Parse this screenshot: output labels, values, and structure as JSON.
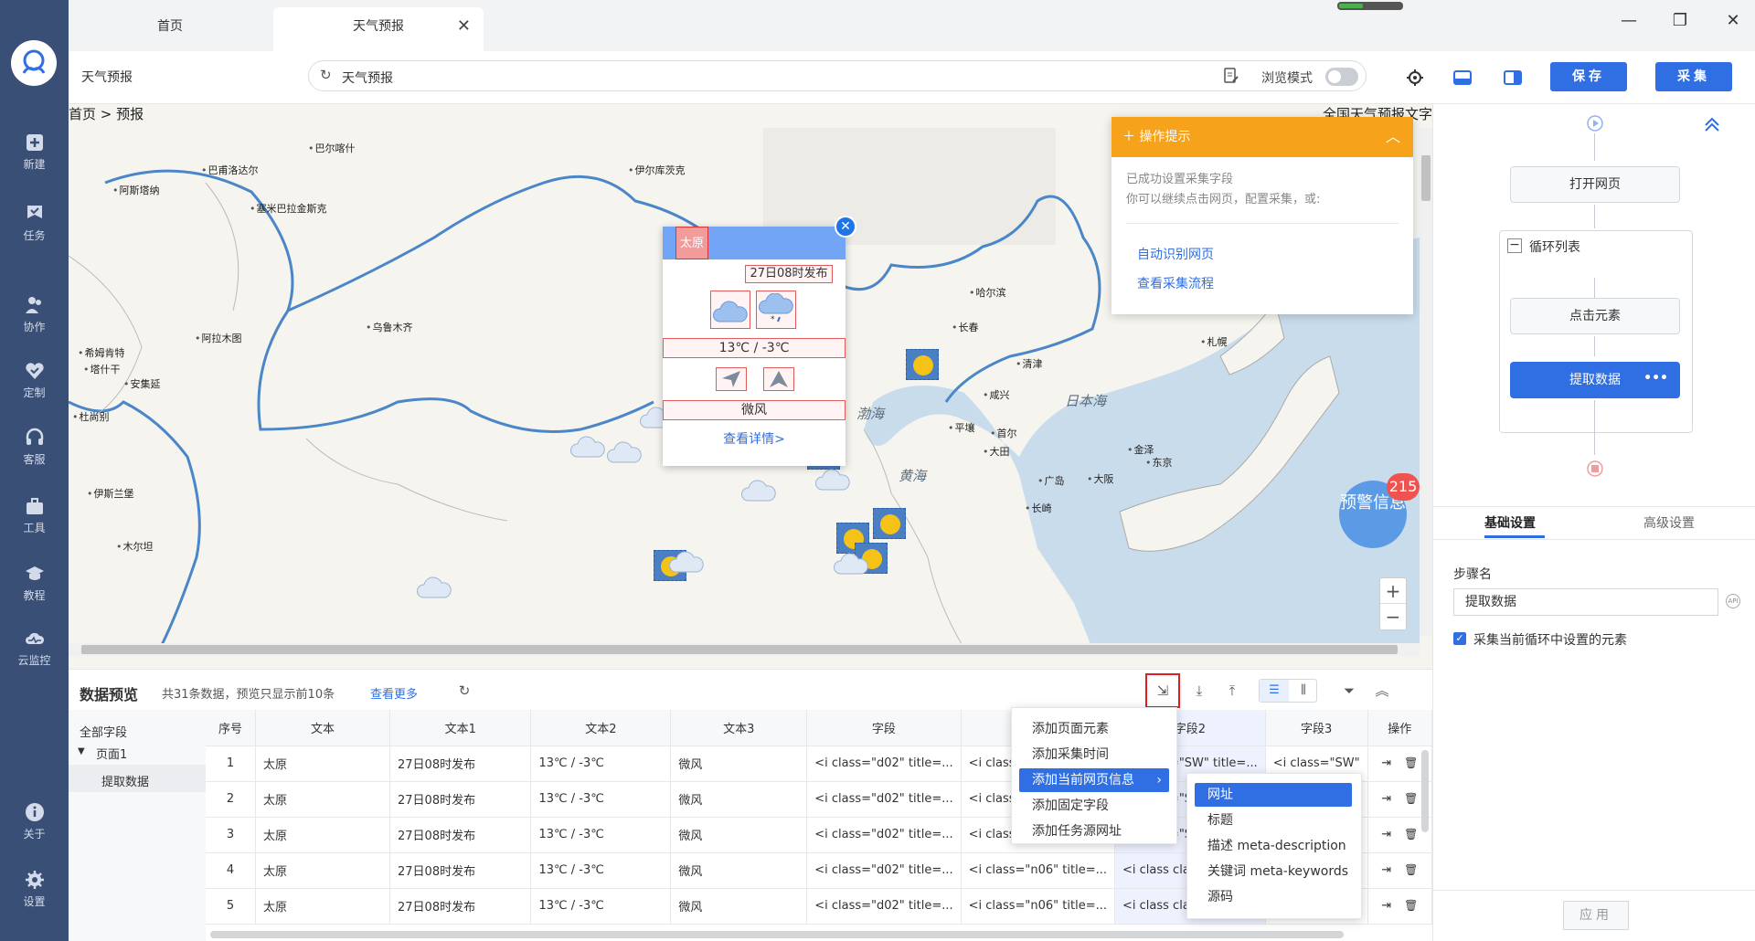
{
  "nav": {
    "items": [
      {
        "label": "新建",
        "icon": "plus-square-icon"
      },
      {
        "label": "任务",
        "icon": "task-flag-icon"
      },
      {
        "label": "协作",
        "icon": "people-icon"
      },
      {
        "label": "定制",
        "icon": "heart-check-icon"
      },
      {
        "label": "客服",
        "icon": "headset-icon"
      },
      {
        "label": "工具",
        "icon": "toolbox-icon"
      },
      {
        "label": "教程",
        "icon": "graduation-cap-icon"
      },
      {
        "label": "云监控",
        "icon": "cloud-monitor-icon"
      },
      {
        "label": "关于",
        "icon": "info-icon"
      },
      {
        "label": "设置",
        "icon": "gear-icon"
      }
    ]
  },
  "tabs": [
    {
      "label": "首页"
    },
    {
      "label": "天气预报"
    }
  ],
  "toolbar": {
    "page_name": "天气预报",
    "url_text": "天气预报",
    "browse_mode": "浏览模式",
    "save_label": "保存",
    "collect_label": "采集"
  },
  "page": {
    "breadcrumb": "首页 > 预报",
    "top_right": "全国天气预报文字"
  },
  "map": {
    "cities": [
      {
        "name": "巴尔喀什"
      },
      {
        "name": "巴甫洛达尔"
      },
      {
        "name": "伊尔库茨克"
      },
      {
        "name": "阿斯塔纳"
      },
      {
        "name": "塞米巴拉金斯克"
      },
      {
        "name": "哈尔滨"
      },
      {
        "name": "长春"
      },
      {
        "name": "乌鲁木齐"
      },
      {
        "name": "阿拉木图"
      },
      {
        "name": "希姆肯特"
      },
      {
        "name": "塔什干"
      },
      {
        "name": "安集延"
      },
      {
        "name": "杜尚别"
      },
      {
        "name": "伊斯兰堡"
      },
      {
        "name": "木尔坦"
      },
      {
        "name": "札幌"
      },
      {
        "name": "清津"
      },
      {
        "name": "咸兴"
      },
      {
        "name": "平壤"
      },
      {
        "name": "首尔"
      },
      {
        "name": "大田"
      },
      {
        "name": "金泽"
      },
      {
        "name": "东京"
      },
      {
        "name": "广岛"
      },
      {
        "name": "大阪"
      },
      {
        "name": "长崎"
      }
    ],
    "seas": [
      {
        "name": "渤海"
      },
      {
        "name": "黄海"
      },
      {
        "name": "日本海"
      }
    ],
    "warning": {
      "label": "预警信息",
      "count": "215"
    },
    "zoom_in": "+",
    "zoom_out": "−"
  },
  "popup": {
    "tag": "太原",
    "publish": "27日08时发布",
    "temp": "13℃ / -3℃",
    "wind": "微风",
    "detail": "查看详情>"
  },
  "hint": {
    "title": "操作提示",
    "line1": "已成功设置采集字段",
    "line2": "你可以继续点击网页，配置采集，或:",
    "link1": "自动识别网页",
    "link2": "查看采集流程"
  },
  "flow": {
    "open_page": "打开网页",
    "loop_list": "循环列表",
    "click_element": "点击元素",
    "extract_data": "提取数据"
  },
  "settings": {
    "tab_basic": "基础设置",
    "tab_advanced": "高级设置",
    "step_name_label": "步骤名",
    "step_name_value": "提取数据",
    "checkbox_label": "采集当前循环中设置的元素",
    "apply": "应用"
  },
  "preview": {
    "title": "数据预览",
    "count_text": "共31条数据，预览只显示前10条",
    "more": "查看更多",
    "tree": {
      "all_fields": "全部字段",
      "page1": "页面1",
      "extract": "提取数据"
    },
    "columns": [
      "序号",
      "文本",
      "文本1",
      "文本2",
      "文本3",
      "字段",
      "字段1",
      "字段2",
      "字段3",
      "操作"
    ],
    "rows": [
      {
        "seq": "1",
        "c1": "太原",
        "c2": "27日08时发布",
        "c3": "13℃ / -3℃",
        "c4": "微风",
        "c5": "<i class=\"d02\" title=...",
        "c6": "<i class=\"n06\" title=...",
        "c7": "<i class=\"SW\" title=...",
        "c8": "<i class=\"SW\""
      },
      {
        "seq": "2",
        "c1": "太原",
        "c2": "27日08时发布",
        "c3": "13℃ / -3℃",
        "c4": "微风",
        "c5": "<i class=\"d02\" title=...",
        "c6": "<i class=\"n06\" title=...",
        "c7": "<i class=\"SW\" title=...",
        "c8": "<i class=\"SW\""
      },
      {
        "seq": "3",
        "c1": "太原",
        "c2": "27日08时发布",
        "c3": "13℃ / -3℃",
        "c4": "微风",
        "c5": "<i class=\"d02\" title=...",
        "c6": "<i class=\"n06\" title=...",
        "c7": "<i class=\"SW\" title=...",
        "c8": "<i class=\"SW\""
      },
      {
        "seq": "4",
        "c1": "太原",
        "c2": "27日08时发布",
        "c3": "13℃ / -3℃",
        "c4": "微风",
        "c5": "<i class=\"d02\" title=...",
        "c6": "<i class=\"n06\" title=...",
        "c7": "<i class class=...",
        "c8": "<i class=\"SW\""
      },
      {
        "seq": "5",
        "c1": "太原",
        "c2": "27日08时发布",
        "c3": "13℃ / -3℃",
        "c4": "微风",
        "c5": "<i class=\"d02\" title=...",
        "c6": "<i class=\"n06\" title=...",
        "c7": "<i class class=...",
        "c8": "<i class=\"SW\""
      }
    ]
  },
  "context_menu": {
    "items": [
      "添加页面元素",
      "添加采集时间",
      "添加当前网页信息",
      "添加固定字段",
      "添加任务源网址"
    ],
    "submenu": [
      "网址",
      "标题",
      "描述 meta-description",
      "关键词 meta-keywords",
      "源码"
    ]
  },
  "colors": {
    "nav_bg": "#3a4f76",
    "accent": "#2f6fe3",
    "hint_orange": "#f7a21b",
    "popup_header": "#72a5f5"
  }
}
